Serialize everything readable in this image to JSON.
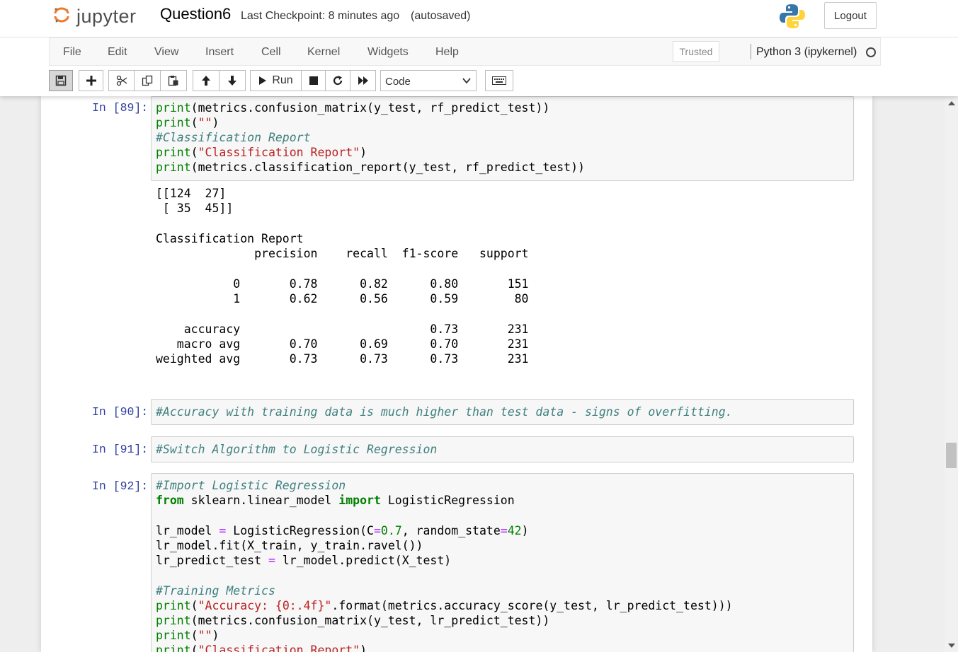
{
  "header": {
    "logo_text": "jupyter",
    "notebook_name": "Question6",
    "checkpoint": "Last Checkpoint: 8 minutes ago",
    "autosave": "(autosaved)",
    "logout": "Logout"
  },
  "menubar": {
    "items": [
      "File",
      "Edit",
      "View",
      "Insert",
      "Cell",
      "Kernel",
      "Widgets",
      "Help"
    ],
    "trusted": "Trusted",
    "kernel": "Python 3 (ipykernel)"
  },
  "toolbar": {
    "run_label": "Run",
    "cell_type": "Code"
  },
  "cells": {
    "c89": {
      "prompt": "In [89]:",
      "lines": [
        "print(metrics.confusion_matrix(y_test, rf_predict_test))",
        "print(\"\")",
        "#Classification Report",
        "print(\"Classification Report\")",
        "print(metrics.classification_report(y_test, rf_predict_test))"
      ],
      "output": [
        "[[124  27]",
        " [ 35  45]]",
        "",
        "Classification Report",
        "              precision    recall  f1-score   support",
        "",
        "           0       0.78      0.82      0.80       151",
        "           1       0.62      0.56      0.59        80",
        "",
        "    accuracy                           0.73       231",
        "   macro avg       0.70      0.69      0.70       231",
        "weighted avg       0.73      0.73      0.73       231"
      ]
    },
    "c90": {
      "prompt": "In [90]:",
      "line": "#Accuracy with training data is much higher than test data - signs of overfitting."
    },
    "c91": {
      "prompt": "In [91]:",
      "line": "#Switch Algorithm to Logistic Regression"
    },
    "c92": {
      "prompt": "In [92]:",
      "comment1": "#Import Logistic Regression",
      "import_from": "from",
      "import_module": " sklearn.linear_model ",
      "import_kw": "import",
      "import_name": " LogisticRegression",
      "line_model_a": "lr_model ",
      "line_model_op": "=",
      "line_model_b": " LogisticRegression(C",
      "line_model_eq": "=",
      "line_model_c": "0.7",
      "line_model_d": ", random_state",
      "line_model_eq2": "=",
      "line_model_e": "42",
      "line_model_f": ")",
      "line_fit": "lr_model.fit(X_train, y_train.ravel())",
      "line_pred_a": "lr_predict_test ",
      "line_pred_op": "=",
      "line_pred_b": " lr_model.predict(X_test)",
      "comment2": "#Training Metrics",
      "acc_fn": "print",
      "acc_str": "\"Accuracy: {0:.4f}\"",
      "acc_rest": ".format(metrics.accuracy_score(y_test, lr_predict_test)))",
      "cm_fn": "print",
      "cm_rest": "(metrics.confusion_matrix(y_test, lr_predict_test))",
      "blank_fn": "print",
      "blank_rest": "(",
      "blank_str": "\"\"",
      "blank_end": ")",
      "last_fn": "print",
      "last_rest": "(",
      "last_str": "\"Classification Report\"",
      "last_end": ")"
    }
  }
}
